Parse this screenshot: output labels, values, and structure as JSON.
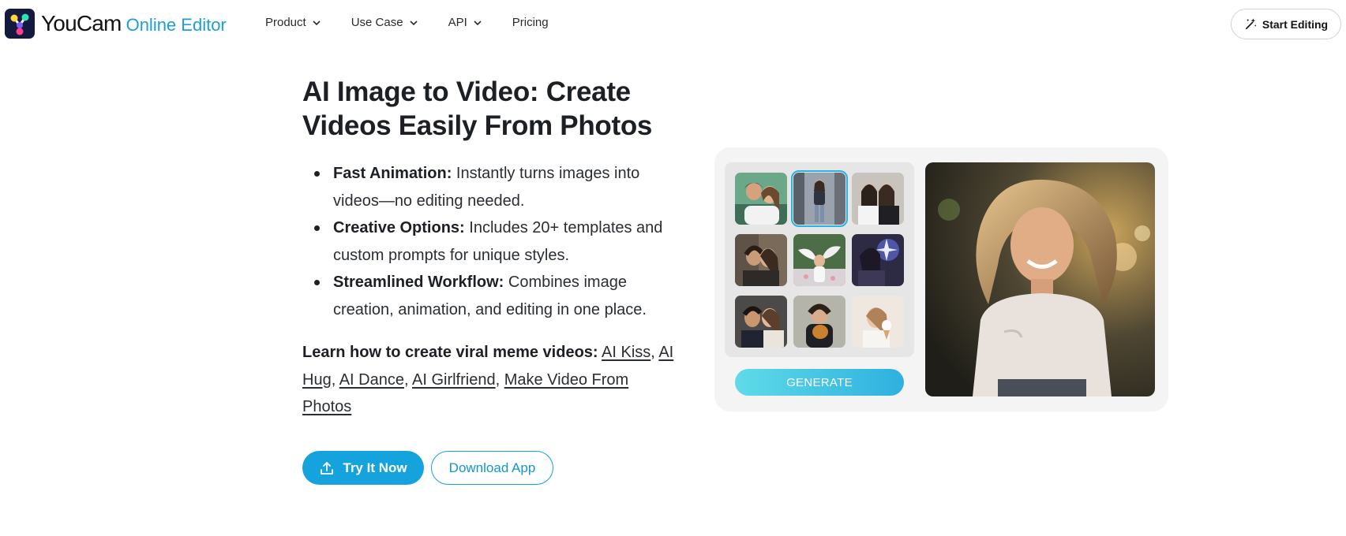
{
  "header": {
    "brand_name": "YouCam",
    "brand_sub": "Online Editor",
    "nav": [
      {
        "label": "Product",
        "has_menu": true
      },
      {
        "label": "Use Case",
        "has_menu": true
      },
      {
        "label": "API",
        "has_menu": true
      },
      {
        "label": "Pricing",
        "has_menu": false
      }
    ],
    "start_label": "Start Editing"
  },
  "hero": {
    "title": "AI Image to Video: Create Videos Easily From Photos",
    "features": [
      {
        "title": "Fast Animation:",
        "text": " Instantly turns images into videos—no editing needed."
      },
      {
        "title": "Creative Options:",
        "text": " Includes 20+ templates and custom prompts for unique styles."
      },
      {
        "title": "Streamlined Workflow:",
        "text": " Combines image creation, animation, and editing in one place."
      }
    ],
    "learn_label": "Learn how to create viral meme videos:",
    "links": [
      "AI Kiss",
      "AI Hug",
      "AI Dance",
      "AI Girlfriend",
      "Make Video From Photos"
    ],
    "try_label": "Try It Now",
    "download_label": "Download App"
  },
  "demo": {
    "generate_label": "GENERATE",
    "selected_thumbnail": 2,
    "colors": {
      "accent": "#14a3dc",
      "generate_start": "#5fdbe8",
      "generate_end": "#2eb0e0"
    }
  }
}
